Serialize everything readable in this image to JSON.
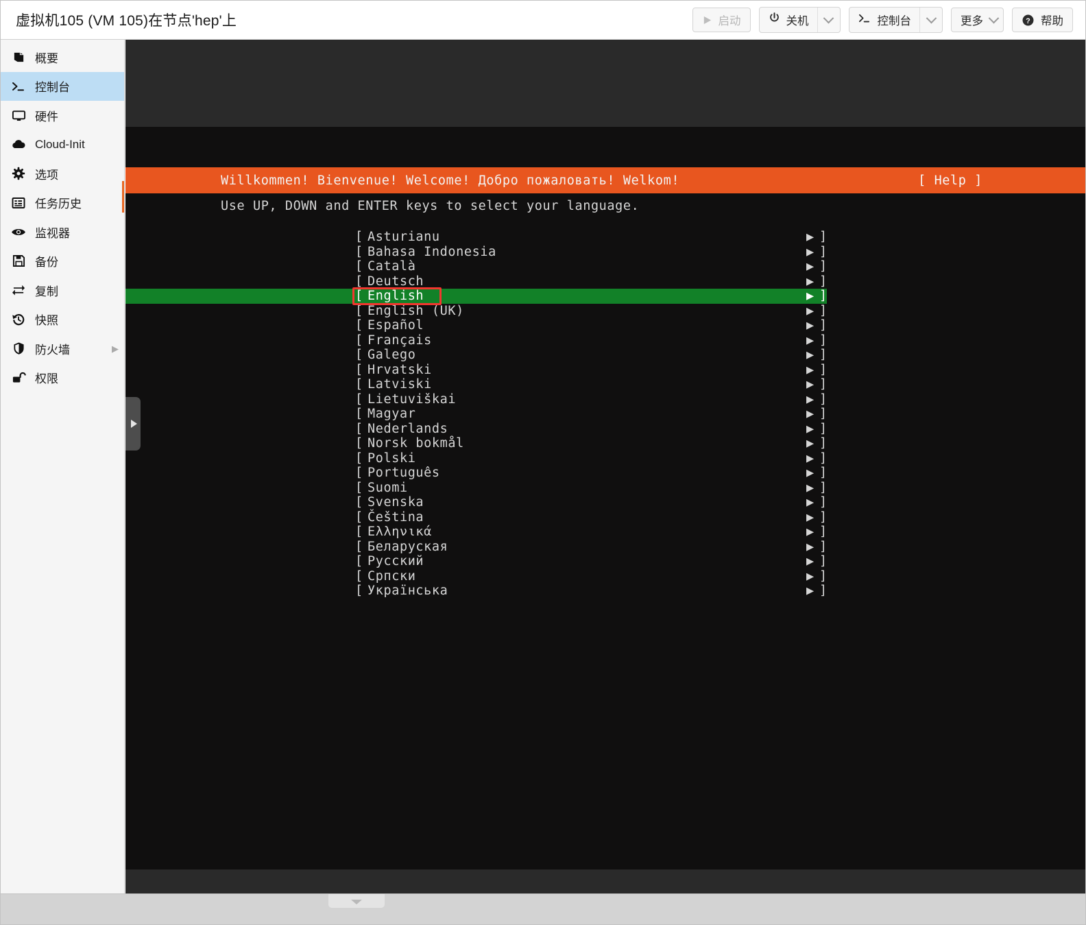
{
  "header": {
    "vm_title": "虚拟机105 (VM 105)在节点'hep'上",
    "buttons": {
      "start": {
        "label": "启动",
        "icon": "play-icon",
        "disabled": true
      },
      "shutdown": {
        "label": "关机",
        "icon": "power-icon",
        "has_dropdown": true
      },
      "console": {
        "label": "控制台",
        "icon": "terminal-icon",
        "has_dropdown": true
      },
      "more": {
        "label": "更多",
        "has_dropdown": true
      },
      "help": {
        "label": "帮助",
        "icon": "question-circle-icon"
      }
    }
  },
  "sidebar": {
    "items": [
      {
        "label": "概要",
        "icon": "book-icon",
        "active": false,
        "has_submenu": false
      },
      {
        "label": "控制台",
        "icon": "terminal-icon",
        "active": true,
        "has_submenu": false
      },
      {
        "label": "硬件",
        "icon": "monitor-icon",
        "active": false,
        "has_submenu": false
      },
      {
        "label": "Cloud-Init",
        "icon": "cloud-icon",
        "active": false,
        "has_submenu": false
      },
      {
        "label": "选项",
        "icon": "gear-icon",
        "active": false,
        "has_submenu": false
      },
      {
        "label": "任务历史",
        "icon": "list-icon",
        "active": false,
        "has_submenu": false
      },
      {
        "label": "监视器",
        "icon": "eye-icon",
        "active": false,
        "has_submenu": false
      },
      {
        "label": "备份",
        "icon": "floppy-icon",
        "active": false,
        "has_submenu": false
      },
      {
        "label": "复制",
        "icon": "sync-icon",
        "active": false,
        "has_submenu": false
      },
      {
        "label": "快照",
        "icon": "history-icon",
        "active": false,
        "has_submenu": false
      },
      {
        "label": "防火墙",
        "icon": "shield-icon",
        "active": false,
        "has_submenu": true
      },
      {
        "label": "权限",
        "icon": "unlock-icon",
        "active": false,
        "has_submenu": false
      }
    ]
  },
  "console": {
    "banner": {
      "welcome": "Willkommen! Bienvenue! Welcome! Добро пожаловать! Welkom!",
      "help": "[ Help ]",
      "background_color": "#e8561f"
    },
    "instruction": "Use UP, DOWN and ENTER keys to select your language.",
    "selected_index": 4,
    "highlight_color": "#128128",
    "annotation_color": "#f2372f",
    "bracket_open": "[",
    "bracket_close": "]",
    "arrow_glyph": "▶",
    "languages": [
      "Asturianu",
      "Bahasa Indonesia",
      "Català",
      "Deutsch",
      "English",
      "English (UK)",
      "Español",
      "Français",
      "Galego",
      "Hrvatski",
      "Latviski",
      "Lietuviškai",
      "Magyar",
      "Nederlands",
      "Norsk bokmål",
      "Polski",
      "Português",
      "Suomi",
      "Svenska",
      "Čeština",
      "Ελληνικά",
      "Беларуская",
      "Русский",
      "Српски",
      "Українська"
    ]
  }
}
